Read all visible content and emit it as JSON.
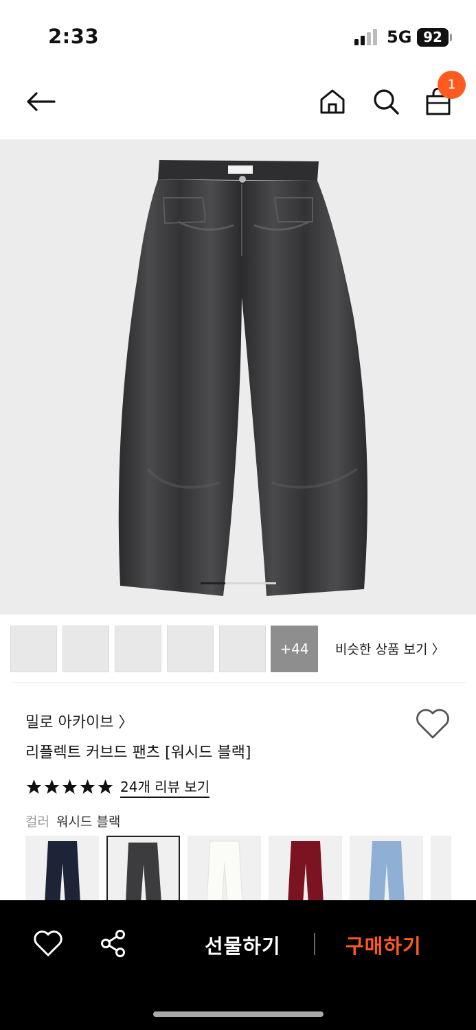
{
  "status": {
    "time": "2:33",
    "network": "5G",
    "battery": "92"
  },
  "header": {
    "back_icon": "arrow-left-icon",
    "home_icon": "home-icon",
    "search_icon": "search-icon",
    "cart_icon": "shopping-bag-icon",
    "cart_count": "1"
  },
  "gallery": {
    "more_count": "+44",
    "similar_link": "비슷한 상품 보기 〉"
  },
  "product": {
    "brand": "밀로 아카이브 〉",
    "name": "리플렉트 커브드 팬츠 [워시드 블랙]",
    "rating_stars": 5,
    "review_link": "24개 리뷰 보기",
    "color_label": "컬러",
    "color_value": "워시드 블랙",
    "swatches": [
      "navy",
      "washed-black",
      "white",
      "burgundy",
      "light-blue",
      "more"
    ]
  },
  "bottom_bar": {
    "gift_label": "선물하기",
    "buy_label": "구매하기"
  },
  "colors": {
    "accent": "#ff5a1f",
    "bar_bg": "#000000"
  }
}
